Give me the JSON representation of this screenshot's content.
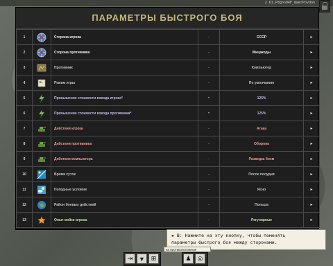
{
  "window": {
    "version_text": "2.61.Pdgon94F_maerPovdon"
  },
  "panel": {
    "title": "ПАРАМЕТРЫ БЫСТРОГО БОЯ"
  },
  "rows": [
    {
      "num": "1",
      "label": "Сторона игрока",
      "dot": "-",
      "value": "СССР",
      "arrow": "▸",
      "icon": "globe-icon",
      "color": "c-white"
    },
    {
      "num": "2",
      "label": "Сторона противника",
      "dot": "-",
      "value": "Мицакоды",
      "arrow": "▸",
      "icon": "globe-icon",
      "color": "c-white"
    },
    {
      "num": "3",
      "label": "Противник",
      "dot": "-",
      "value": "Компьютер",
      "arrow": "▸",
      "icon": "map-icon",
      "color": "c-gray"
    },
    {
      "num": "4",
      "label": "Режим игры",
      "dot": "-",
      "value": "По умолчанию",
      "arrow": "▸",
      "icon": "flag-icon",
      "color": "c-gray"
    },
    {
      "num": "5",
      "label": "Превышение стоимости взвода игрока*",
      "dot": "•",
      "value": "125%",
      "arrow": "▸",
      "icon": "bolt-icon",
      "color": "c-purple"
    },
    {
      "num": "6",
      "label": "Превышение стоимости взвода противника*",
      "dot": "•",
      "value": "125%",
      "arrow": "▸",
      "icon": "bolt-icon",
      "color": "c-purple"
    },
    {
      "num": "7",
      "label": "Действия игрока",
      "dot": "-",
      "value": "Атака",
      "arrow": "▸",
      "icon": "tank-icon",
      "color": "c-pink"
    },
    {
      "num": "8",
      "label": "Действия противника",
      "dot": "-",
      "value": "Оборона",
      "arrow": "▸",
      "icon": "tank-icon",
      "color": "c-pink"
    },
    {
      "num": "9",
      "label": "Действия компьютера",
      "dot": "-",
      "value": "Разведка боем",
      "arrow": "▸",
      "icon": "tank-icon",
      "color": "c-pink"
    },
    {
      "num": "10",
      "label": "Время суток",
      "dot": "-",
      "value": "После полудня",
      "arrow": "▸",
      "icon": "sun-icon",
      "color": "c-gray"
    },
    {
      "num": "11",
      "label": "Погодные условия",
      "dot": "-",
      "value": "Ясно",
      "arrow": "▸",
      "icon": "weather-icon",
      "color": "c-gray"
    },
    {
      "num": "12",
      "label": "Район боевых действий",
      "dot": "-",
      "value": "Польша",
      "arrow": "▸",
      "icon": "earth-icon",
      "color": "c-gray"
    },
    {
      "num": "13",
      "label": "Опыт войск игрока",
      "dot": "-",
      "value": "Регулярные",
      "arrow": "▸",
      "icon": "star-icon",
      "color": "c-lgreen"
    }
  ],
  "tooltip": {
    "line1": "B: Нажмите на эту кнопку, чтобы поменять",
    "line2": "параметры быстрого боя между сторонами."
  },
  "hint": {
    "text": "на противоположные"
  },
  "toolbar": {
    "exit_icon": "exit-icon",
    "menu_icon": "menu-icon",
    "swap_icon": "swap-icon",
    "soldier_icon": "soldier-icon",
    "target_icon": "target-icon"
  }
}
